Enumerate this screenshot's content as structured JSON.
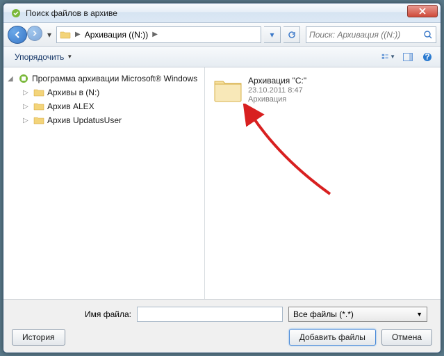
{
  "window": {
    "title": "Поиск файлов в архиве"
  },
  "breadcrumb": {
    "segments": [
      "",
      "Архивация ((N:))",
      ""
    ]
  },
  "search": {
    "placeholder": "Поиск: Архивация ((N:))"
  },
  "toolbar": {
    "organize": "Упорядочить"
  },
  "sidebar": {
    "root": "Программа архивации Microsoft® Windows",
    "items": [
      {
        "label": "Архивы в (N:)"
      },
      {
        "label": "Архив ALEX"
      },
      {
        "label": "Архив UpdatusUser"
      }
    ]
  },
  "content": {
    "item": {
      "name": "Архивация \"C:\"",
      "date": "23.10.2011 8:47",
      "type": "Архивация"
    }
  },
  "footer": {
    "filename_label": "Имя файла:",
    "filename_value": "",
    "filetype": "Все файлы (*.*)",
    "history": "История",
    "add": "Добавить файлы",
    "cancel": "Отмена"
  }
}
